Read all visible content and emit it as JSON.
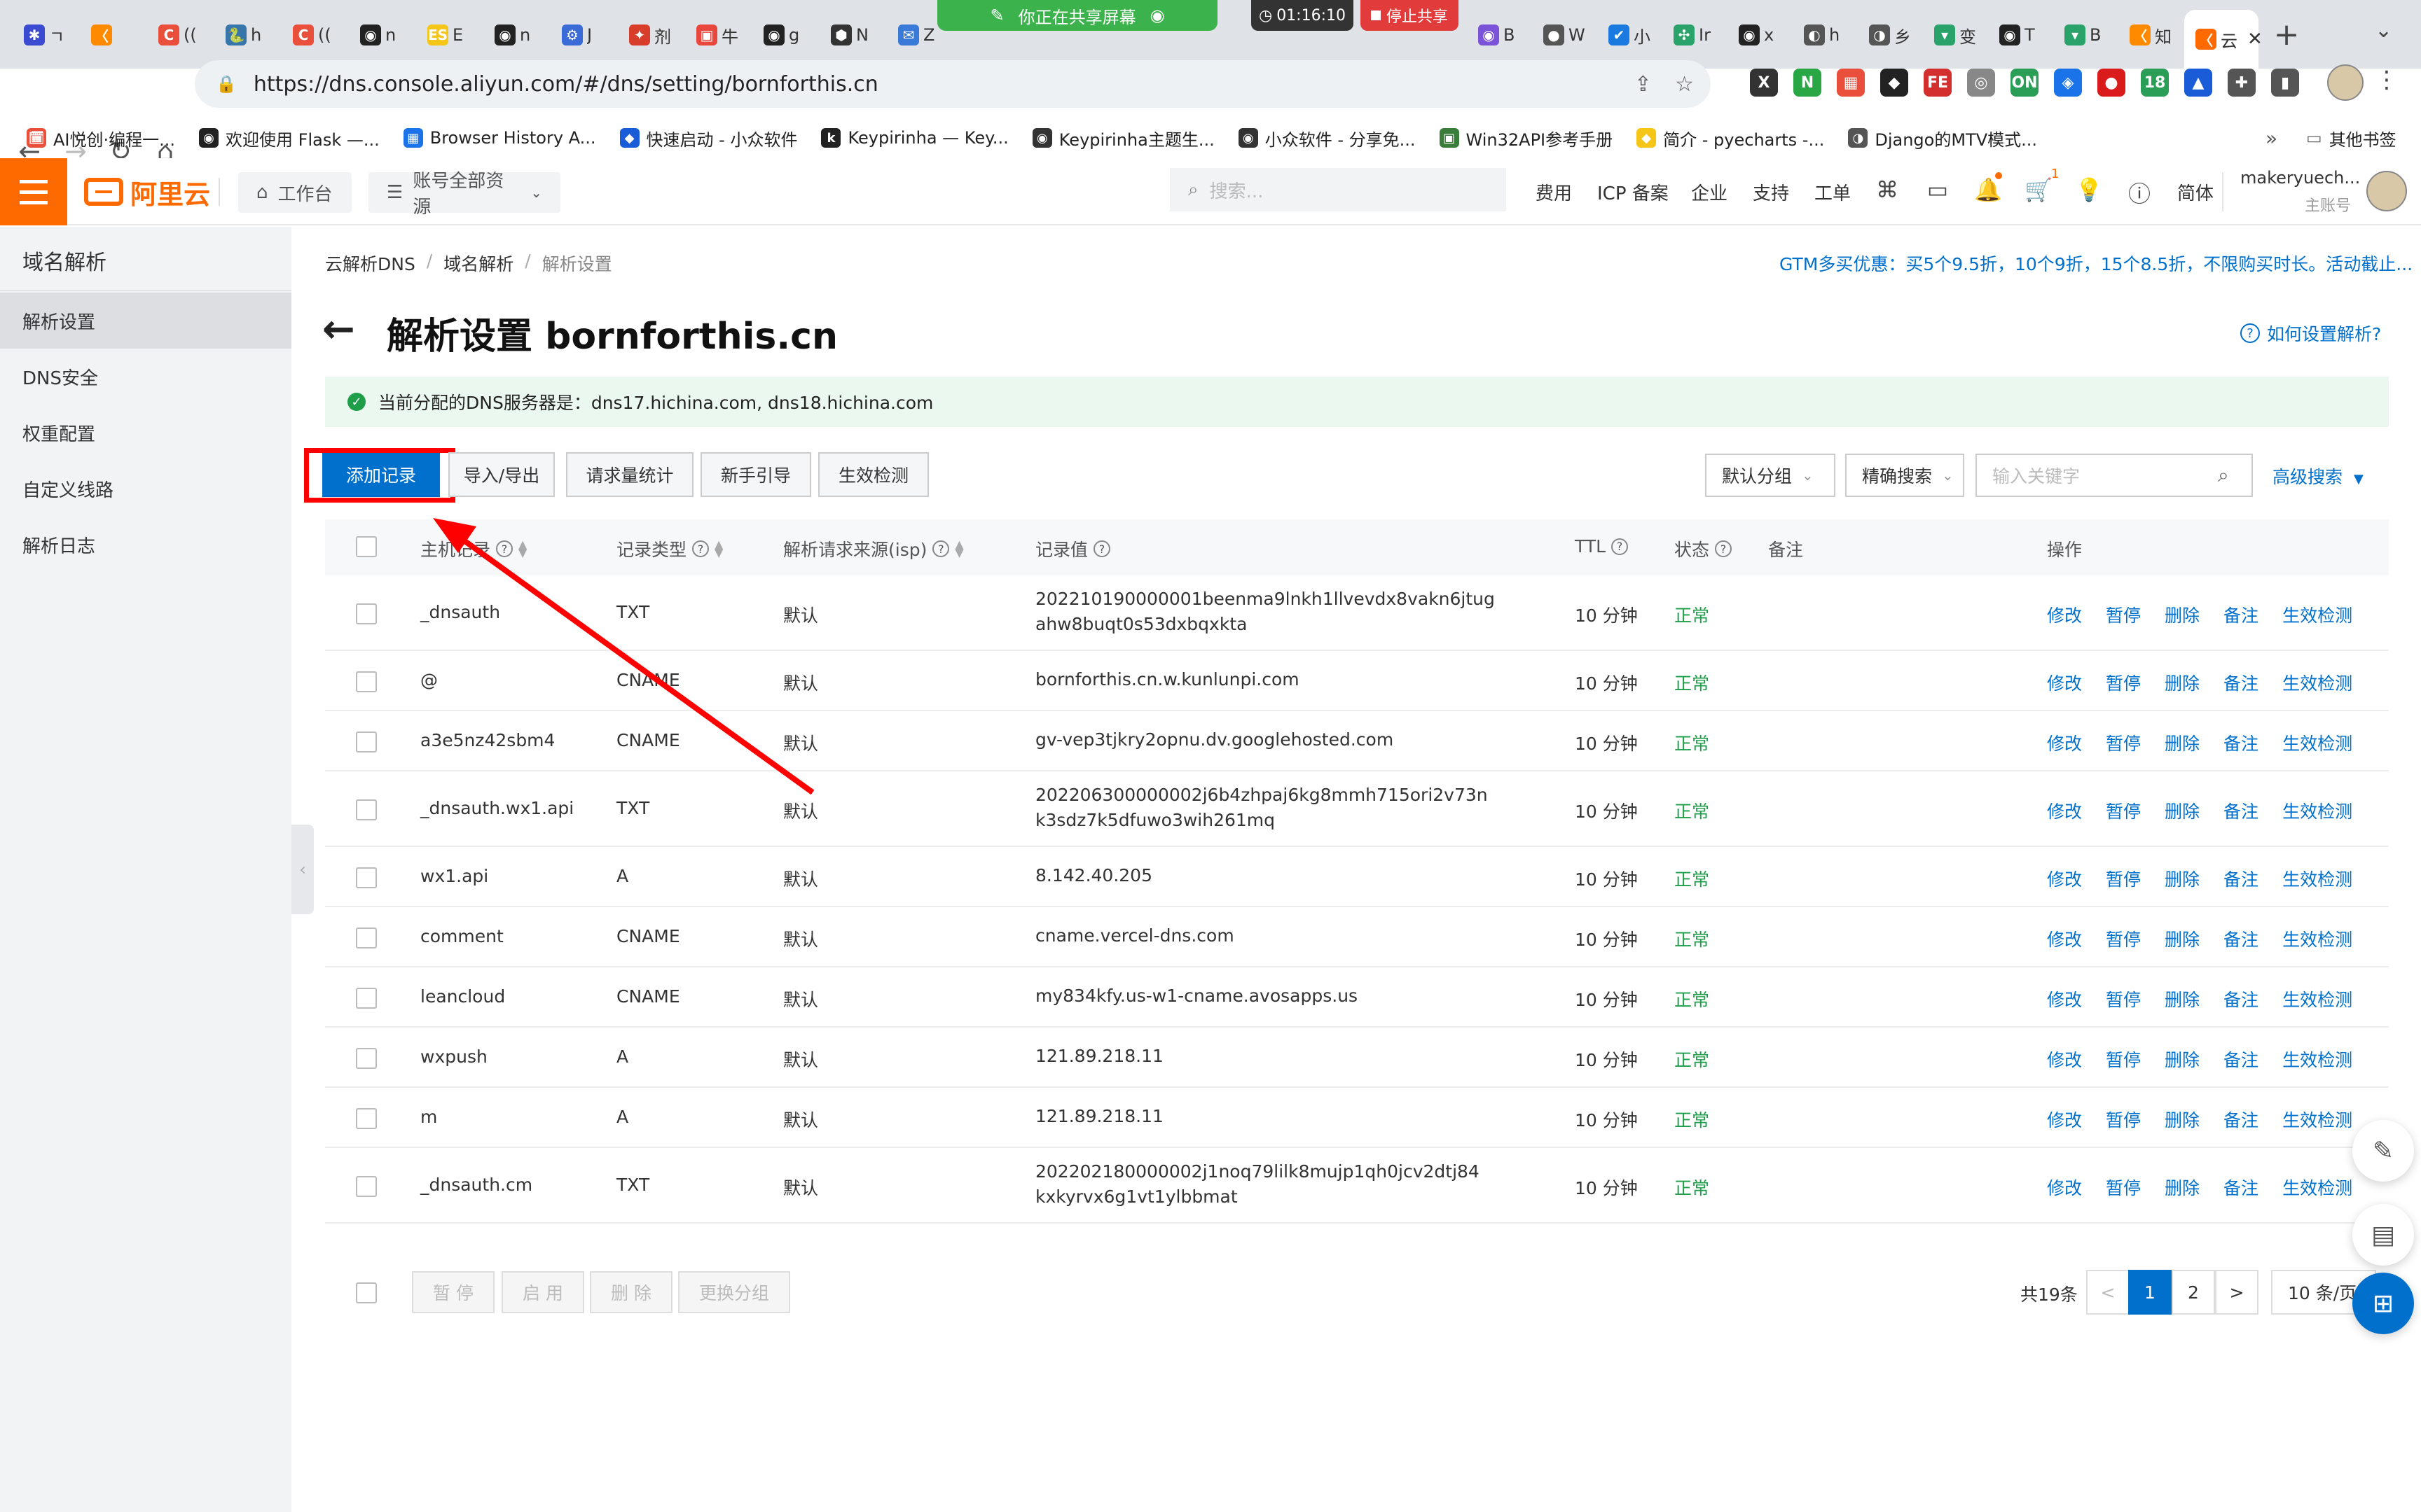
{
  "browser": {
    "tabs": [
      {
        "icon": "✱",
        "color": "#3b4bd1",
        "label": "ㄱ"
      },
      {
        "icon": "〈",
        "color": "#ff8a00",
        "label": ""
      },
      {
        "icon": "C",
        "color": "#e94f3a",
        "label": "(("
      },
      {
        "icon": "🐍",
        "color": "#3776ab",
        "label": "h"
      },
      {
        "icon": "C",
        "color": "#e94f3a",
        "label": "(("
      },
      {
        "icon": "◉",
        "color": "#222",
        "label": "n"
      },
      {
        "icon": "ES",
        "color": "#f5c518",
        "label": "E"
      },
      {
        "icon": "◉",
        "color": "#222",
        "label": "n"
      },
      {
        "icon": "⚙",
        "color": "#3b6bd6",
        "label": "J"
      },
      {
        "icon": "✦",
        "color": "#d83c2a",
        "label": "剂"
      },
      {
        "icon": "▣",
        "color": "#e9473d",
        "label": "牛"
      },
      {
        "icon": "◉",
        "color": "#222",
        "label": "g"
      },
      {
        "icon": "⬢",
        "color": "#333",
        "label": "N"
      },
      {
        "icon": "✉",
        "color": "#3979d8",
        "label": "Z"
      }
    ],
    "tabs_right": [
      {
        "icon": "◉",
        "color": "#7a53d8",
        "label": "B"
      },
      {
        "icon": "●",
        "color": "#555",
        "label": "W"
      },
      {
        "icon": "✔",
        "color": "#1a7ae0",
        "label": "小"
      },
      {
        "icon": "✣",
        "color": "#2aa36b",
        "label": "Ir"
      },
      {
        "icon": "◉",
        "color": "#222",
        "label": "x"
      },
      {
        "icon": "◐",
        "color": "#555",
        "label": "h"
      },
      {
        "icon": "◑",
        "color": "#555",
        "label": "乡"
      },
      {
        "icon": "▾",
        "color": "#2aa36b",
        "label": "变"
      },
      {
        "icon": "◉",
        "color": "#222",
        "label": "T"
      },
      {
        "icon": "▾",
        "color": "#2aa36b",
        "label": "B"
      },
      {
        "icon": "〈",
        "color": "#ff8a00",
        "label": "知"
      }
    ],
    "active_tab_label": "云",
    "new_tab": "+",
    "share": {
      "banner": "你正在共享屏幕",
      "timer": "01:16:10",
      "stop": "停止共享"
    },
    "url": "https://dns.console.aliyun.com/#/dns/setting/bornforthis.cn",
    "extensions": [
      {
        "icon": "X",
        "color": "#333"
      },
      {
        "icon": "N",
        "color": "#29a745"
      },
      {
        "icon": "▦",
        "color": "#e94f3a"
      },
      {
        "icon": "◆",
        "color": "#222"
      },
      {
        "icon": "FE",
        "color": "#d32f2f"
      },
      {
        "icon": "◎",
        "color": "#888"
      },
      {
        "icon": "ON",
        "color": "#2a9d56"
      },
      {
        "icon": "◈",
        "color": "#1a73e8"
      },
      {
        "icon": "●",
        "color": "#d91b1b"
      },
      {
        "icon": "18",
        "color": "#2a9d56"
      },
      {
        "icon": "▲",
        "color": "#1a5cd8"
      },
      {
        "icon": "✚",
        "color": "#555"
      },
      {
        "icon": "▮",
        "color": "#555"
      }
    ],
    "bookmarks": [
      {
        "icon": "🗓",
        "color": "#e94f3a",
        "label": "AI悦创·编程一..."
      },
      {
        "icon": "◉",
        "color": "#222",
        "label": "欢迎使用 Flask —..."
      },
      {
        "icon": "▦",
        "color": "#1a73e8",
        "label": "Browser History A..."
      },
      {
        "icon": "◆",
        "color": "#1a5cd8",
        "label": "快速启动 - 小众软件"
      },
      {
        "icon": "k",
        "color": "#222",
        "label": "Keypirinha — Key..."
      },
      {
        "icon": "◉",
        "color": "#333",
        "label": "Keypirinha主题生..."
      },
      {
        "icon": "◉",
        "color": "#333",
        "label": "小众软件 - 分享免..."
      },
      {
        "icon": "▣",
        "color": "#3a7d3a",
        "label": "Win32API参考手册"
      },
      {
        "icon": "◆",
        "color": "#f5c518",
        "label": "简介 - pyecharts -..."
      },
      {
        "icon": "◑",
        "color": "#555",
        "label": "Django的MTV模式..."
      }
    ],
    "bookmarks_more": "»",
    "other_bookmarks": "其他书签"
  },
  "console": {
    "logo": "阿里云",
    "workbench": "工作台",
    "resources": "账号全部资源",
    "search_placeholder": "搜索...",
    "nav": [
      "费用",
      "ICP 备案",
      "企业",
      "支持",
      "工单"
    ],
    "lang": "简体",
    "user_name": "makeryuech...",
    "user_role": "主账号",
    "cart_badge": "1"
  },
  "sidebar": {
    "title": "域名解析",
    "items": [
      "解析设置",
      "DNS安全",
      "权重配置",
      "自定义线路",
      "解析日志"
    ]
  },
  "main": {
    "breadcrumb": [
      "云解析DNS",
      "域名解析",
      "解析设置"
    ],
    "promo": "GTM多买优惠：买5个9.5折，10个9折，15个8.5折，不限购买时长。活动截止...",
    "title": "解析设置 bornforthis.cn",
    "howto": "如何设置解析?",
    "dns_notice": "当前分配的DNS服务器是：dns17.hichina.com, dns18.hichina.com",
    "buttons": [
      "添加记录",
      "导入/导出",
      "请求量统计",
      "新手引导",
      "生效检测"
    ],
    "group_select": "默认分组",
    "search_mode": "精确搜索",
    "keyword_placeholder": "输入关键字",
    "advanced_search": "高级搜索"
  },
  "table": {
    "headers": [
      "主机记录",
      "记录类型",
      "解析请求来源(isp)",
      "记录值",
      "TTL",
      "状态",
      "备注",
      "操作"
    ],
    "actions": [
      "修改",
      "暂停",
      "删除",
      "备注",
      "生效检测"
    ],
    "rows": [
      {
        "host": "_dnsauth",
        "type": "TXT",
        "isp": "默认",
        "value1": "202210190000001beenma9lnkh1llvevdx8vakn6jtug",
        "value2": "ahw8buqt0s53dxbqxkta",
        "ttl": "10 分钟",
        "status": "正常"
      },
      {
        "host": "@",
        "type": "CNAME",
        "isp": "默认",
        "value1": "bornforthis.cn.w.kunlunpi.com",
        "value2": "",
        "ttl": "10 分钟",
        "status": "正常"
      },
      {
        "host": "a3e5nz42sbm4",
        "type": "CNAME",
        "isp": "默认",
        "value1": "gv-vep3tjkry2opnu.dv.googlehosted.com",
        "value2": "",
        "ttl": "10 分钟",
        "status": "正常"
      },
      {
        "host": "_dnsauth.wx1.api",
        "type": "TXT",
        "isp": "默认",
        "value1": "202206300000002j6b4zhpaj6kg8mmh715ori2v73n",
        "value2": "k3sdz7k5dfuwo3wih261mq",
        "ttl": "10 分钟",
        "status": "正常"
      },
      {
        "host": "wx1.api",
        "type": "A",
        "isp": "默认",
        "value1": "8.142.40.205",
        "value2": "",
        "ttl": "10 分钟",
        "status": "正常"
      },
      {
        "host": "comment",
        "type": "CNAME",
        "isp": "默认",
        "value1": "cname.vercel-dns.com",
        "value2": "",
        "ttl": "10 分钟",
        "status": "正常"
      },
      {
        "host": "leancloud",
        "type": "CNAME",
        "isp": "默认",
        "value1": "my834kfy.us-w1-cname.avosapps.us",
        "value2": "",
        "ttl": "10 分钟",
        "status": "正常"
      },
      {
        "host": "wxpush",
        "type": "A",
        "isp": "默认",
        "value1": "121.89.218.11",
        "value2": "",
        "ttl": "10 分钟",
        "status": "正常"
      },
      {
        "host": "m",
        "type": "A",
        "isp": "默认",
        "value1": "121.89.218.11",
        "value2": "",
        "ttl": "10 分钟",
        "status": "正常"
      },
      {
        "host": "_dnsauth.cm",
        "type": "TXT",
        "isp": "默认",
        "value1": "202202180000002j1noq79lilk8mujp1qh0jcv2dtj84",
        "value2": "kxkyrvx6g1vt1ylbbmat",
        "ttl": "10 分钟",
        "status": "正常"
      }
    ]
  },
  "footer": {
    "bulk": [
      "暂 停",
      "启 用",
      "删 除",
      "更换分组"
    ],
    "total": "共19条",
    "pages": [
      "1",
      "2"
    ],
    "prev": "<",
    "next": ">",
    "page_size": "10 条/页"
  },
  "colors": {
    "accent": "#0070cc",
    "brand": "#ff6a00",
    "ok": "#1e9e49",
    "annotation": "#ff0000"
  }
}
